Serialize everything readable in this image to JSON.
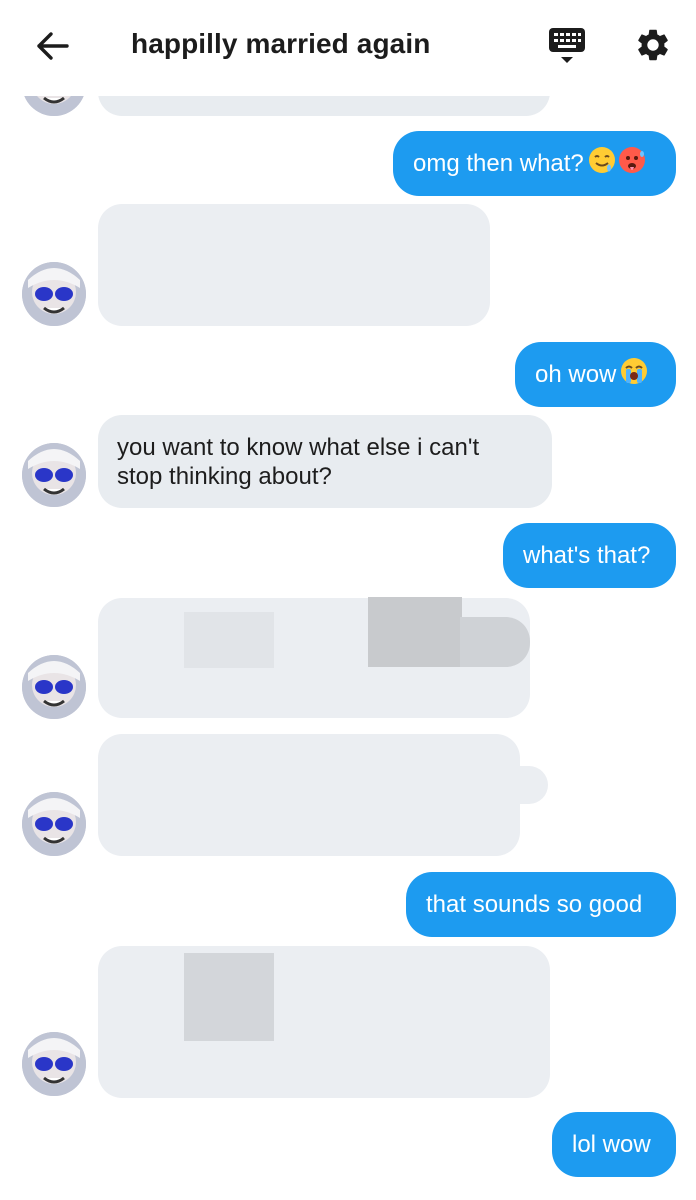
{
  "header": {
    "title": "happilly married again",
    "back_icon": "arrow-left-icon",
    "keyboard_icon": "keyboard-icon",
    "settings_icon": "gear-icon"
  },
  "colors": {
    "outgoing_bubble": "#1d9bf0",
    "incoming_bubble": "#e8ecf0",
    "background": "#ffffff"
  },
  "messages": [
    {
      "direction": "in",
      "text": ""
    },
    {
      "direction": "out",
      "text": "omg then what?",
      "emoji": [
        "drooling-face",
        "hot-face"
      ]
    },
    {
      "direction": "in",
      "text": ""
    },
    {
      "direction": "out",
      "text": "oh wow",
      "emoji": [
        "loudly-crying-face"
      ]
    },
    {
      "direction": "in",
      "line1": "you want to know what else i can't",
      "line2": "stop thinking about?"
    },
    {
      "direction": "out",
      "text": "what's that?"
    },
    {
      "direction": "in",
      "text": ""
    },
    {
      "direction": "in",
      "text": ""
    },
    {
      "direction": "out",
      "text": "that sounds so good"
    },
    {
      "direction": "in",
      "text": ""
    },
    {
      "direction": "out",
      "text": "lol wow"
    }
  ]
}
